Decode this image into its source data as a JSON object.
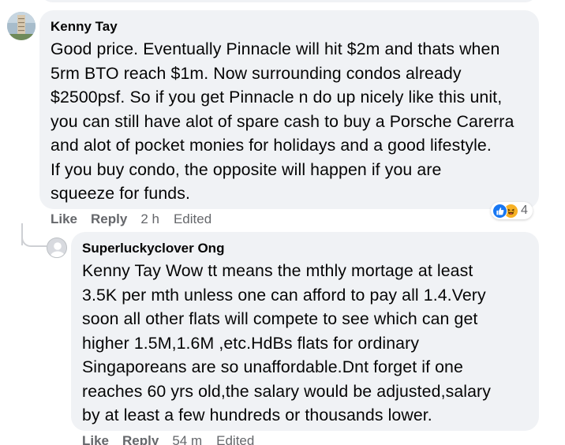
{
  "comment": {
    "author": "Kenny Tay",
    "text": "Good price. Eventually Pinnacle will hit $2m and thats when\n5rm BTO reach $1m. Now surrounding condos already\n$2500psf. So if you get Pinnacle n do up nicely like this unit,\nyou can still have alot of spare cash to buy a Porsche Carerra\nand alot of pocket monies for holidays and a good lifestyle.\nIf you buy condo, the opposite will happen if you are\nsqueeze for funds.",
    "actions": {
      "like": "Like",
      "reply": "Reply",
      "time": "2 h",
      "edited": "Edited"
    },
    "reactions": {
      "icons": [
        "like-icon",
        "haha-icon"
      ],
      "count": "4",
      "like_color": "#1877f2",
      "haha_color": "#f7b125"
    }
  },
  "reply": {
    "author": "Superluckyclover Ong",
    "text": "Kenny Tay Wow tt means the mthly mortage at least\n3.5K per mth unless one can afford to pay all 1.4.Very\nsoon all other flats will compete to see which can get\nhigher 1.5M,1.6M ,etc.HdBs flats for ordinary\nSingaporeans are so unaffordable.Dnt forget if one\nreaches 60 yrs old,the salary would be adjusted,salary\nby at least a few hundreds or thousands lower.",
    "actions": {
      "like": "Like",
      "reply": "Reply",
      "time": "54 m",
      "edited": "Edited"
    }
  },
  "colors": {
    "bubble_bg": "#f0f2f5",
    "secondary_text": "#65676b",
    "primary_text": "#050505"
  }
}
